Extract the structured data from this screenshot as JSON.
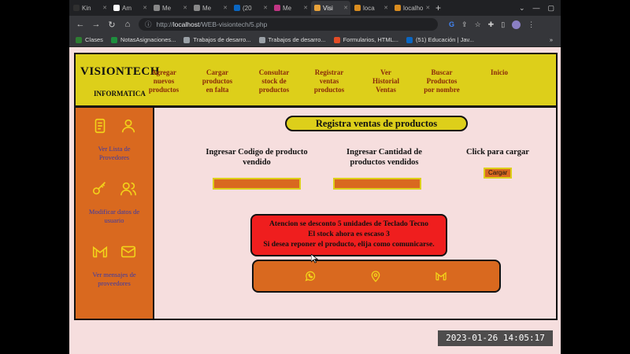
{
  "browser": {
    "tabs": [
      {
        "label": "Kin",
        "color": "#2f2f2f"
      },
      {
        "label": "Am",
        "color": "#ffffff"
      },
      {
        "label": "Me",
        "color": "#888888"
      },
      {
        "label": "Me",
        "color": "#888888"
      },
      {
        "label": "(20",
        "color": "#0a66c2"
      },
      {
        "label": "Me",
        "color": "#c13584"
      },
      {
        "label": "Visi",
        "color": "#e8a23a",
        "active": true
      },
      {
        "label": "loca",
        "color": "#d98c1f"
      },
      {
        "label": "localho",
        "color": "#d98c1f"
      }
    ],
    "url_scheme": "http://",
    "url_host": "localhost",
    "url_path": "/WEB-visiontech/5.php",
    "bookmarks": [
      {
        "label": "Clases",
        "color": "#2e7d32"
      },
      {
        "label": "NotasAsignaciones...",
        "color": "#1e8e3e"
      },
      {
        "label": "Trabajos de desarro...",
        "color": "#9aa0a6"
      },
      {
        "label": "Trabajos de desarro...",
        "color": "#9aa0a6"
      },
      {
        "label": "Formularios, HTML...",
        "color": "#e34c26"
      },
      {
        "label": "(51) Educación | Jav...",
        "color": "#0a66c2"
      }
    ]
  },
  "site": {
    "brand_name": "VISIONTECH",
    "brand_sub": "INFORMATICA",
    "nav": [
      {
        "label": "Agregar nuevos productos",
        "lines": [
          "Agregar",
          "nuevos",
          "productos"
        ]
      },
      {
        "label": "Cargar productos en falta",
        "lines": [
          "Cargar",
          "productos",
          "en falta"
        ]
      },
      {
        "label": "Consultar stock de productos",
        "lines": [
          "Consultar",
          "stock de",
          "productos"
        ]
      },
      {
        "label": "Registrar ventas productos",
        "lines": [
          "Registrar",
          "ventas",
          "productos"
        ]
      },
      {
        "label": "Ver Historial Ventas",
        "lines": [
          "Ver",
          "Historial",
          "Ventas"
        ]
      },
      {
        "label": "Buscar Productos por nombre",
        "lines": [
          "Buscar",
          "Productos",
          "por nombre"
        ]
      },
      {
        "label": "Inicio",
        "lines": [
          "Inicio"
        ]
      }
    ],
    "sidebar": [
      {
        "label_lines": [
          "Ver Lista de",
          "Provedores"
        ],
        "icons": [
          "document-icon",
          "user-icon"
        ]
      },
      {
        "label_lines": [
          "Modificar datos de",
          "usuario"
        ],
        "icons": [
          "key-icon",
          "users-icon"
        ]
      },
      {
        "label_lines": [
          "Ver mensajes de",
          "proveedores"
        ],
        "icons": [
          "gmail-icon",
          "mail-icon"
        ]
      }
    ],
    "page_title": "Registra ventas de productos",
    "col1_lines": [
      "Ingresar Codigo de producto",
      "vendido"
    ],
    "col2_lines": [
      "Ingresar Cantidad de",
      "productos vendidos"
    ],
    "col3_label": "Click para cargar",
    "cargar_label": "Cargar",
    "alert_lines": [
      "Atencion se desconto 5 unidades de Teclado Tecno",
      "El stock ahora es escaso 3",
      "Si desea reponer el producto, elija como comunicarse."
    ],
    "contact_icons": [
      "whatsapp-icon",
      "location-icon",
      "gmail-icon"
    ]
  },
  "timestamp": "2023-01-26  14:05:17",
  "colors": {
    "header_yellow": "#ddcf1a",
    "sidebar_orange": "#d9691f",
    "alert_red": "#ef1e1e",
    "page_bg": "#f6dede",
    "icon_yellow": "#f2d21a"
  }
}
